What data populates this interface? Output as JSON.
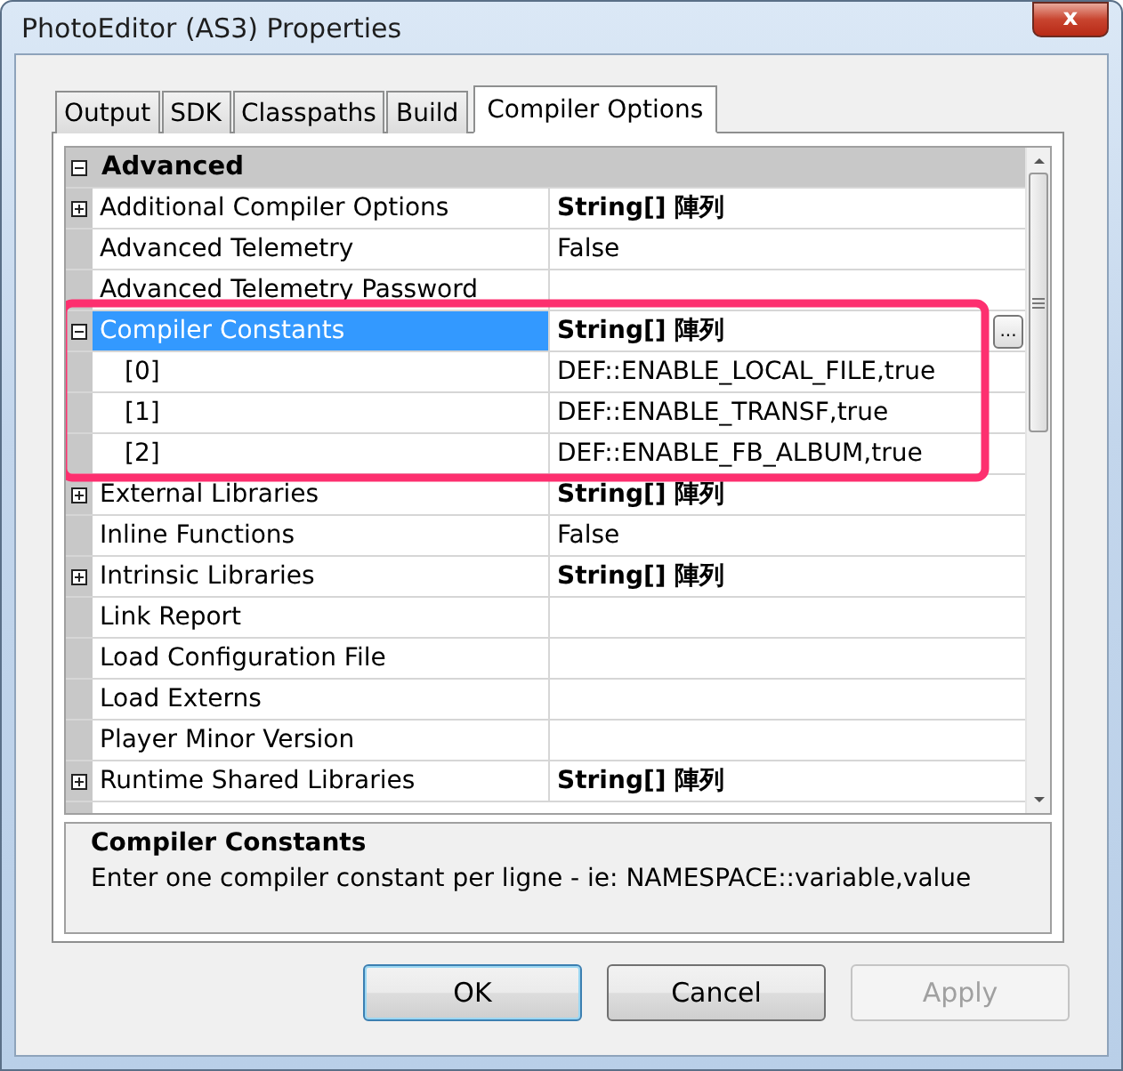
{
  "window": {
    "title": "PhotoEditor (AS3) Properties",
    "close": "x"
  },
  "tabs": [
    {
      "label": "Output",
      "selected": false
    },
    {
      "label": "SDK",
      "selected": false
    },
    {
      "label": "Classpaths",
      "selected": false
    },
    {
      "label": "Build",
      "selected": false
    },
    {
      "label": "Compiler Options",
      "selected": true
    }
  ],
  "grid": {
    "rows": [
      {
        "kind": "category",
        "name": "Advanced",
        "expanded": true
      },
      {
        "kind": "property",
        "name": "Additional Compiler Options",
        "value": "String[] 陣列",
        "value_bold": true,
        "expandable": true,
        "expanded": false,
        "selected": false
      },
      {
        "kind": "property",
        "name": "Advanced Telemetry",
        "value": "False",
        "value_bold": false,
        "expandable": false,
        "selected": false
      },
      {
        "kind": "property",
        "name": "Advanced Telemetry Password",
        "expandable": false,
        "selected": false
      },
      {
        "kind": "property",
        "name": "Compiler Constants",
        "value": "String[] 陣列",
        "value_bold": true,
        "expandable": true,
        "expanded": true,
        "selected": true,
        "edit_button": "...",
        "children": [
          {
            "kind": "property",
            "name": "[0]",
            "value": "DEF::ENABLE_LOCAL_FILE,true",
            "value_bold": false,
            "expandable": false,
            "selected": false
          },
          {
            "kind": "property",
            "name": "[1]",
            "value": "DEF::ENABLE_TRANSF,true",
            "value_bold": false,
            "expandable": false,
            "selected": false
          },
          {
            "kind": "property",
            "name": "[2]",
            "value": "DEF::ENABLE_FB_ALBUM,true",
            "value_bold": false,
            "expandable": false,
            "selected": false
          }
        ]
      },
      {
        "kind": "property",
        "name": "External Libraries",
        "value": "String[] 陣列",
        "value_bold": true,
        "expandable": true,
        "expanded": false,
        "selected": false
      },
      {
        "kind": "property",
        "name": "Inline Functions",
        "value": "False",
        "value_bold": false,
        "expandable": false,
        "selected": false
      },
      {
        "kind": "property",
        "name": "Intrinsic Libraries",
        "value": "String[] 陣列",
        "value_bold": true,
        "expandable": true,
        "expanded": false,
        "selected": false
      },
      {
        "kind": "property",
        "name": "Link Report",
        "expandable": false,
        "selected": false
      },
      {
        "kind": "property",
        "name": "Load Configuration File",
        "expandable": false,
        "selected": false
      },
      {
        "kind": "property",
        "name": "Load Externs",
        "expandable": false,
        "selected": false
      },
      {
        "kind": "property",
        "name": "Player Minor Version",
        "expandable": false,
        "selected": false
      },
      {
        "kind": "property",
        "name": "Runtime Shared Libraries",
        "value": "String[] 陣列",
        "value_bold": true,
        "expandable": true,
        "expanded": false,
        "selected": false
      }
    ]
  },
  "description": {
    "title": "Compiler Constants",
    "text": "Enter one compiler constant per ligne - ie: NAMESPACE::variable,value"
  },
  "buttons": [
    {
      "label": "OK",
      "default": true,
      "disabled": false
    },
    {
      "label": "Cancel",
      "default": false,
      "disabled": false
    },
    {
      "label": "Apply",
      "default": false,
      "disabled": true
    }
  ]
}
